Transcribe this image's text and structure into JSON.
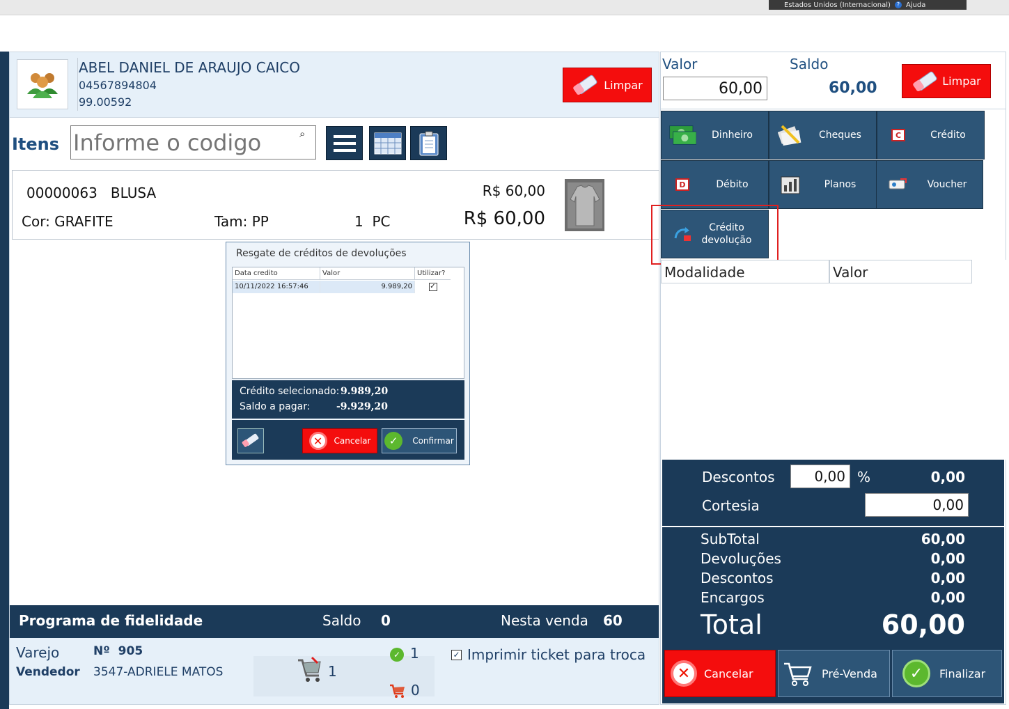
{
  "topbar": {
    "keyboard_label": "Estados Unidos (Internacional)",
    "help_label": "Ajuda"
  },
  "customer": {
    "name": "ABEL DANIEL DE ARAUJO  CAICO",
    "document": "04567894804",
    "code": "99.00592",
    "clear_label": "Limpar"
  },
  "items": {
    "label": "Itens",
    "search_placeholder": "Informe o codigo"
  },
  "product": {
    "code": "00000063",
    "name": "BLUSA",
    "color": "Cor: GRAFITE",
    "size": "Tam: PP",
    "qty": "1",
    "unit": "PC",
    "unit_price": "R$ 60,00",
    "total_price": "R$ 60,00"
  },
  "dialog": {
    "title": "Resgate de créditos de devoluções",
    "columns": [
      "Data credito",
      "Valor",
      "Utilizar?"
    ],
    "rows": [
      {
        "date": "10/11/2022 16:57:46",
        "value": "9.989,20",
        "use": true
      }
    ],
    "selected_label": "Crédito selecionado:",
    "selected_value": "9.989,20",
    "due_label": "Saldo a pagar:",
    "due_value": "-9.929,20",
    "cancel_label": "Cancelar",
    "confirm_label": "Confirmar"
  },
  "loyalty": {
    "title": "Programa de fidelidade",
    "balance_label": "Saldo",
    "balance_value": "0",
    "this_sale_label": "Nesta venda",
    "this_sale_value": "60"
  },
  "footer": {
    "channel": "Varejo",
    "number_label": "Nº",
    "number": "905",
    "seller_label": "Vendedor",
    "seller": "3547-ADRIELE MATOS",
    "cart_count": "1",
    "ok_count": "1",
    "cart2_count": "0",
    "ticket_label": "Imprimir ticket para troca"
  },
  "payment": {
    "value_label": "Valor",
    "value": "60,00",
    "balance_label": "Saldo",
    "balance": "60,00",
    "clear_label": "Limpar",
    "methods": [
      "Dinheiro",
      "Cheques",
      "Crédito",
      "Débito",
      "Planos",
      "Voucher"
    ],
    "credit_return_line1": "Crédito",
    "credit_return_line2": "devolução",
    "table_col1": "Modalidade",
    "table_col2": "Valor"
  },
  "totals": {
    "discounts_label": "Descontos",
    "discount_input": "0,00",
    "percent": "%",
    "discount_value": "0,00",
    "courtesy_label": "Cortesia",
    "courtesy_input": "0,00",
    "subtotal_label": "SubTotal",
    "subtotal": "60,00",
    "returns_label": "Devoluções",
    "returns": "0,00",
    "discounts2_label": "Descontos",
    "discounts2": "0,00",
    "charges_label": "Encargos",
    "charges": "0,00",
    "total_label": "Total",
    "total": "60,00"
  },
  "actions": {
    "cancel": "Cancelar",
    "presale": "Pré-Venda",
    "finish": "Finalizar"
  },
  "colors": {
    "navy": "#1b3a58",
    "red": "#f40d0d",
    "light": "#e6f0f9",
    "highlight": "#e02020"
  }
}
